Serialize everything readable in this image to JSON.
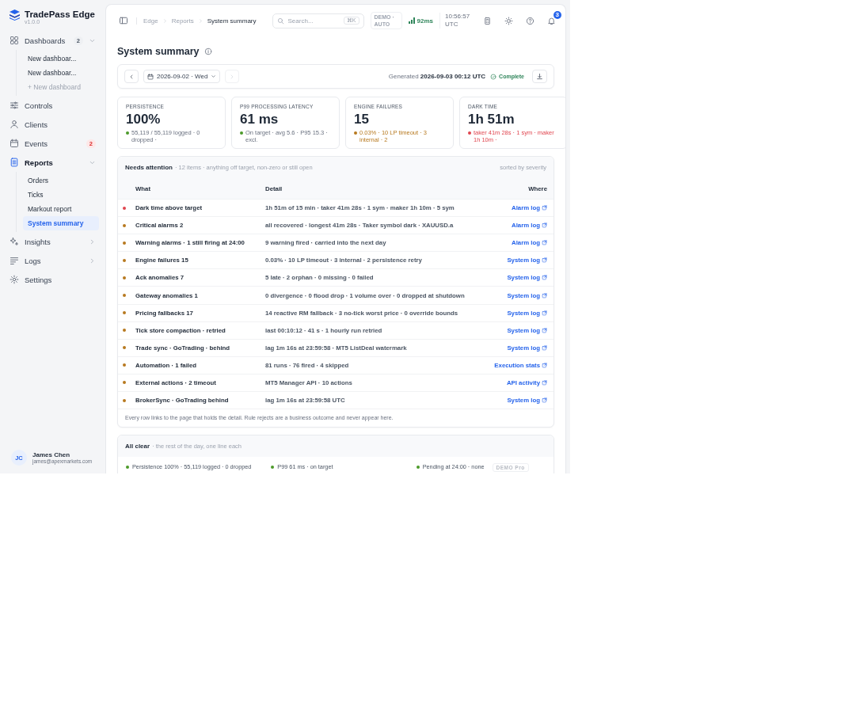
{
  "app": {
    "name": "TradePass Edge",
    "version": "v1.0.0"
  },
  "sidebar": {
    "items": [
      {
        "label": "Dashboards",
        "count": "2",
        "expanded": true,
        "selected": false,
        "children": [
          {
            "label": "New dashboar...",
            "kind": "link",
            "selected": false
          },
          {
            "label": "New dashboar...",
            "kind": "link",
            "selected": false
          },
          {
            "label": "+ New dashboard",
            "kind": "add",
            "selected": false
          }
        ]
      },
      {
        "label": "Controls",
        "selected": false
      },
      {
        "label": "Clients",
        "selected": false
      },
      {
        "label": "Events",
        "alert": "2",
        "selected": false
      },
      {
        "label": "Reports",
        "expanded": true,
        "selected": true,
        "children": [
          {
            "label": "Orders",
            "kind": "link",
            "selected": false
          },
          {
            "label": "Ticks",
            "kind": "link",
            "selected": false
          },
          {
            "label": "Markout report",
            "kind": "link",
            "selected": false
          },
          {
            "label": "System summary",
            "kind": "link",
            "selected": true
          }
        ]
      },
      {
        "label": "Insights",
        "expanded": false,
        "selected": false
      },
      {
        "label": "Logs",
        "expanded": false,
        "selected": false
      },
      {
        "label": "Settings",
        "selected": false
      }
    ],
    "user": {
      "initials": "JC",
      "name": "James Chen",
      "email": "james@apexmarkets.com"
    }
  },
  "topbar": {
    "breadcrumb": [
      "Edge",
      "Reports",
      "System summary"
    ],
    "search": {
      "placeholder": "Search...",
      "shortcut": "⌘K"
    },
    "mode": "DEMO · AUTO",
    "latency": "92ms",
    "time": "10:56:57 UTC",
    "notifications": "3"
  },
  "page": {
    "title": "System summary"
  },
  "toolbar": {
    "date": "2026-09-02 · Wed",
    "next_disabled": true,
    "generated": "Generated **2026-09-03 00:12 UTC**",
    "status": "Complete"
  },
  "cards": [
    {
      "label": "PERSISTENCE",
      "value": "100%",
      "color": "#4c9a2a",
      "kind": "neutral",
      "detail": "55,119 / 55,119 logged · 0 dropped ·"
    },
    {
      "label": "P99 PROCESSING LATENCY",
      "value": "61 ms",
      "color": "#4c9a2a",
      "kind": "neutral",
      "detail": "On target · avg 5.6 · P95 15.3 · excl."
    },
    {
      "label": "ENGINE FAILURES",
      "value": "15",
      "color": "#b7791f",
      "kind": "tinted",
      "detail": "0.03% · 10 LP timeout · 3 internal · 2"
    },
    {
      "label": "DARK TIME",
      "value": "1h 51m",
      "color": "#e0454f",
      "kind": "tinted",
      "detail": "taker 41m 28s · 1 sym · maker 1h 10m ·"
    }
  ],
  "attention": {
    "title": "Needs attention",
    "subtitle": "· 12 items · anything off target, non-zero or still open",
    "sort": "sorted by severity",
    "columns": [
      "What",
      "Detail",
      "Where"
    ],
    "rows": [
      {
        "color": "#e0454f",
        "what": "Dark time above target",
        "detail": "1h 51m of 15 min · taker 41m 28s · 1 sym · maker 1h 10m · 5 sym",
        "where": "Alarm log"
      },
      {
        "color": "#b7791f",
        "what": "Critical alarms 2",
        "detail": "all recovered · longest 41m 28s · Taker symbol dark · XAUUSD.a",
        "where": "Alarm log"
      },
      {
        "color": "#b7791f",
        "what": "Warning alarms · 1 still firing at 24:00",
        "detail": "9 warning fired · carried into the next day",
        "where": "Alarm log"
      },
      {
        "color": "#b7791f",
        "what": "Engine failures 15",
        "detail": "0.03% · 10 LP timeout · 3 internal · 2 persistence retry",
        "where": "System log"
      },
      {
        "color": "#b7791f",
        "what": "Ack anomalies 7",
        "detail": "5 late · 2 orphan · 0 missing · 0 failed",
        "where": "System log"
      },
      {
        "color": "#b7791f",
        "what": "Gateway anomalies 1",
        "detail": "0 divergence · 0 flood drop · 1 volume over · 0 dropped at shutdown",
        "where": "System log"
      },
      {
        "color": "#b7791f",
        "what": "Pricing fallbacks 17",
        "detail": "14 reactive RM fallback · 3 no-tick worst price · 0 override bounds",
        "where": "System log"
      },
      {
        "color": "#b7791f",
        "what": "Tick store compaction · retried",
        "detail": "last 00:10:12 · 41 s · 1 hourly run retried",
        "where": "System log"
      },
      {
        "color": "#b7791f",
        "what": "Trade sync · GoTrading · behind",
        "detail": "lag 1m 16s at 23:59:58 · MT5 ListDeal watermark",
        "where": "System log"
      },
      {
        "color": "#b7791f",
        "what": "Automation · 1 failed",
        "detail": "81 runs · 76 fired · 4 skipped",
        "where": "Execution stats"
      },
      {
        "color": "#b7791f",
        "what": "External actions · 2 timeout",
        "detail": "MT5 Manager API · 10 actions",
        "where": "API activity"
      },
      {
        "color": "#b7791f",
        "what": "BrokerSync · GoTrading behind",
        "detail": "lag 1m 16s at 23:59:58 UTC",
        "where": "System log"
      }
    ],
    "footnote": "Every row links to the page that holds the detail. Rule rejects are a business outcome and never appear here."
  },
  "all_clear": {
    "title": "All clear",
    "subtitle": "· the rest of the day, one line each",
    "items": [
      {
        "color": "#4c9a2a",
        "text": "Persistence 100% · 55,119 logged · 0 dropped"
      },
      {
        "color": "#4c9a2a",
        "text": "P99 61 ms · on target"
      },
      {
        "color": "#4c9a2a",
        "text": "Pending at 24:00 · none",
        "badge": "DEMO Pro"
      }
    ]
  }
}
